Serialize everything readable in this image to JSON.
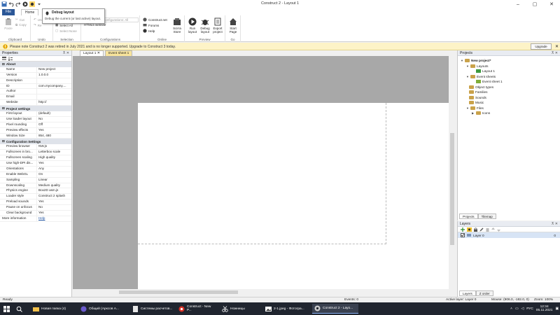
{
  "window": {
    "title": "Construct 2 - Layout 1",
    "min": "–",
    "max": "▢",
    "close": "✕"
  },
  "ribbon_tabs": {
    "file": "File",
    "home": "Home",
    "view": "Vi"
  },
  "ribbon": {
    "paste": "Paste",
    "cut": "Cut",
    "copy": "Copy",
    "undo": "Und",
    "redo": "Re",
    "select_all": "Select All",
    "select_none": "Select None",
    "config_dropdown": "Configurations: All",
    "export_dropdown": "HTML5 website",
    "html5": "HTML5",
    "construct_net": "Construct.net",
    "forums": "Forums",
    "help": "Help",
    "scirra_store_line1": "Scirra",
    "scirra_store_line2": "Store",
    "run_line1": "Run",
    "run_line2": "layout",
    "debug_line1": "Debug",
    "debug_line2": "layout",
    "export_line1": "Export",
    "export_line2": "project",
    "start_line1": "Start",
    "start_line2": "Page",
    "groups": {
      "clipboard": "Clipboard",
      "undo": "Undo",
      "selection": "Selection",
      "configurations": "Configurations",
      "online": "Online",
      "preview": "Preview",
      "go": "Go"
    }
  },
  "tooltip": {
    "title": "Debug layout",
    "body": "Debug the current (or last active) layout."
  },
  "notice": {
    "text": "Please note Construct 2 was retired in July 2021 and is no longer supported. Upgrade to Construct 3 today.",
    "upgrade": "Upgrade",
    "close": "✕"
  },
  "properties": {
    "title": "Properties",
    "pin": "⊼ ✕",
    "sections": [
      {
        "name": "About",
        "rows": [
          {
            "k": "Name",
            "v": "New project"
          },
          {
            "k": "Version",
            "v": "1.0.0.0"
          },
          {
            "k": "Description",
            "v": ""
          },
          {
            "k": "ID",
            "v": "com.mycompany...."
          },
          {
            "k": "Author",
            "v": ""
          },
          {
            "k": "Email",
            "v": ""
          },
          {
            "k": "Website",
            "v": "http://"
          }
        ]
      },
      {
        "name": "Project settings",
        "rows": [
          {
            "k": "First layout",
            "v": "(default)"
          },
          {
            "k": "Use loader layout",
            "v": "No"
          },
          {
            "k": "Pixel rounding",
            "v": "Off"
          },
          {
            "k": "Preview effects",
            "v": "Yes"
          },
          {
            "k": "Window Size",
            "v": "854, 480"
          }
        ]
      },
      {
        "name": "Configuration Settings",
        "rows": [
          {
            "k": "Preview browser",
            "v": "NW.js"
          },
          {
            "k": "Fullscreen in bro...",
            "v": "Letterbox scale"
          },
          {
            "k": "Fullscreen scaling",
            "v": "High quality"
          },
          {
            "k": "Use high-DPI dis...",
            "v": "Yes"
          },
          {
            "k": "Orientations",
            "v": "Any"
          },
          {
            "k": "Enable WebGL",
            "v": "On"
          },
          {
            "k": "Sampling",
            "v": "Linear"
          },
          {
            "k": "Downscaling",
            "v": "Medium quality"
          },
          {
            "k": "Physics engine",
            "v": "Box2D asm.js"
          },
          {
            "k": "Loader style",
            "v": "Construct 2 splash"
          },
          {
            "k": "Preload sounds",
            "v": "Yes"
          },
          {
            "k": "Pause on unfocus",
            "v": "No"
          },
          {
            "k": "Clear background",
            "v": "Yes"
          }
        ]
      }
    ],
    "more_info_label": "More information",
    "more_info_link": "Help"
  },
  "doc_tabs": {
    "layout": "Layout 1",
    "event": "Event sheet 1",
    "close": "✕"
  },
  "projects": {
    "title": "Projects",
    "pin": "⊼ ✕",
    "root": "New project*",
    "items": [
      {
        "label": "Layouts"
      },
      {
        "label": "Layout 1"
      },
      {
        "label": "Event sheets"
      },
      {
        "label": "Event sheet 1"
      },
      {
        "label": "Object types"
      },
      {
        "label": "Families"
      },
      {
        "label": "Sounds"
      },
      {
        "label": "Music"
      },
      {
        "label": "Files"
      },
      {
        "label": "Icons"
      }
    ],
    "tab_projects": "Projects",
    "tab_tilemap": "Tilemap"
  },
  "layers": {
    "title": "Layers",
    "pin": "⊼ ✕",
    "layer0": "Layer 0",
    "layer0_idx": "0",
    "tab_layers": "Layers",
    "tab_zorder": "Z order"
  },
  "status": {
    "ready": "Ready",
    "events": "Events: 0",
    "active_layer": "Active layer: Layer 0",
    "mouse": "Mouse: (906.0, -182.0, 0)",
    "zoom": "Zoom: 100%"
  },
  "taskbar": {
    "items": [
      {
        "label": "Новая папка (4)"
      },
      {
        "label": "Общий (Арксов А..."
      },
      {
        "label": "Системы расчетов..."
      },
      {
        "label": "Construct - New P..."
      },
      {
        "label": "Ножницы"
      },
      {
        "label": "2-1.jpeg - Фотогра..."
      },
      {
        "label": "Construct 2 - Layo..."
      }
    ],
    "lang": "РУС",
    "time": "12:34",
    "date": "05.11.2021"
  }
}
